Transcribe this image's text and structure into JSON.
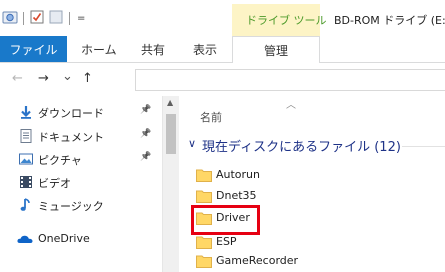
{
  "window": {
    "title": "BD-ROM ドライブ (E:)",
    "context_tab_group": "ドライブ ツール"
  },
  "ribbon": {
    "tabs": [
      {
        "label": "ファイル"
      },
      {
        "label": "ホーム"
      },
      {
        "label": "共有"
      },
      {
        "label": "表示"
      },
      {
        "label": "管理"
      }
    ]
  },
  "quick_access_toolbar": {
    "icons": [
      "explorer-app-icon",
      "properties-check-icon",
      "new-folder-icon",
      "customize-dropdown-icon"
    ],
    "dropdown_glyph": "="
  },
  "navigation": {
    "back_glyph": "←",
    "forward_glyph": "→",
    "recent_glyph": "⌄",
    "up_glyph": "↑"
  },
  "nav_pane": {
    "items": [
      {
        "label": "ダウンロード",
        "icon": "download-arrow-icon",
        "pinned": true
      },
      {
        "label": "ドキュメント",
        "icon": "document-icon",
        "pinned": true
      },
      {
        "label": "ピクチャ",
        "icon": "pictures-icon",
        "pinned": true
      },
      {
        "label": "ビデオ",
        "icon": "video-icon",
        "pinned": false
      },
      {
        "label": "ミュージック",
        "icon": "music-note-icon",
        "pinned": false
      },
      {
        "label": "OneDrive",
        "icon": "onedrive-cloud-icon",
        "pinned": false
      }
    ],
    "pin_glyph": "📌"
  },
  "content": {
    "column_header": "名前",
    "group_label": "現在ディスクにあるファイル (12)",
    "files": [
      {
        "name": "Autorun"
      },
      {
        "name": "Dnet35"
      },
      {
        "name": "Driver"
      },
      {
        "name": "ESP"
      },
      {
        "name": "GameRecorder"
      }
    ],
    "highlighted_file": "Driver"
  },
  "colors": {
    "file_tab": "#1979ca",
    "context_band": "#fdf4c6",
    "context_label": "#4c9a2a",
    "group_label": "#1e3287",
    "folder": "#ffd766",
    "highlight": "#e60012"
  }
}
